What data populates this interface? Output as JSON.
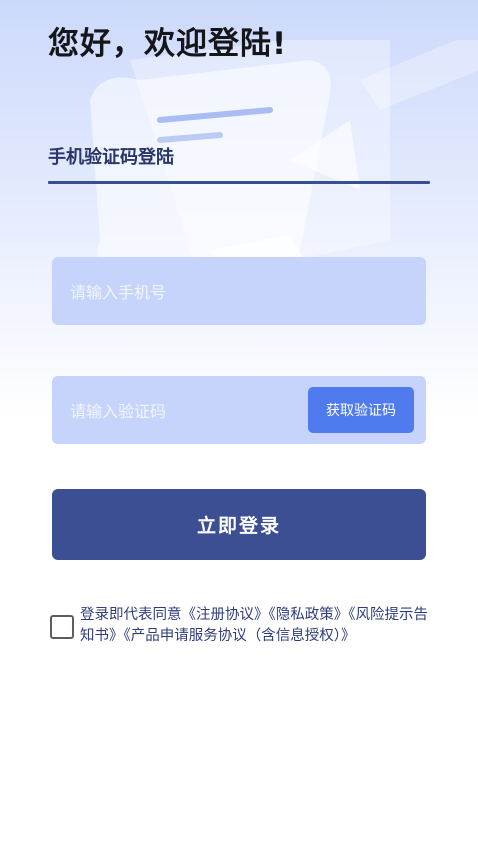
{
  "greeting": "您好，欢迎登陆!",
  "tab_label": "手机验证码登陆",
  "phone_placeholder": "请输入手机号",
  "code_placeholder": "请输入验证码",
  "get_code_label": "获取验证码",
  "login_label": "立即登录",
  "agreement": {
    "prefix": "登录即代表同意",
    "links": [
      "《注册协议》",
      "《隐私政策》",
      "《风险提示告知书》",
      "《产品申请服务协议（含信息授权）》"
    ]
  },
  "colors": {
    "primary": "#3d4f93",
    "field": "#c6d4fc",
    "button_accent": "#4f7bef"
  }
}
